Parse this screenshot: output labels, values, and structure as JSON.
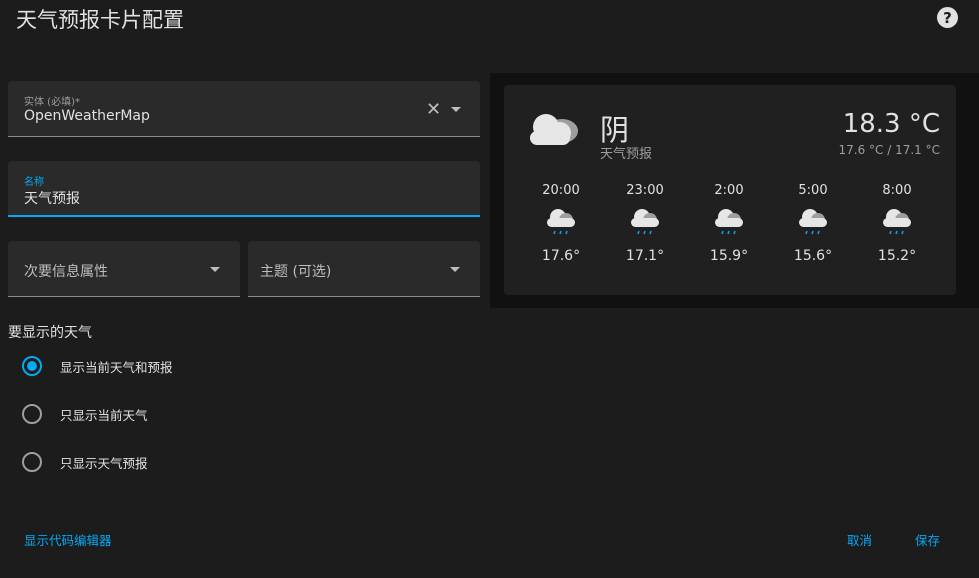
{
  "dialog": {
    "title": "天气预报卡片配置"
  },
  "form": {
    "entity": {
      "label": "实体 (必填)*",
      "value": "OpenWeatherMap"
    },
    "name": {
      "label": "名称",
      "value": "天气预报"
    },
    "secondary": {
      "placeholder": "次要信息属性"
    },
    "theme": {
      "placeholder": "主题 (可选)"
    },
    "show_section": {
      "title": "要显示的天气",
      "options": [
        {
          "label": "显示当前天气和预报",
          "checked": true
        },
        {
          "label": "只显示当前天气",
          "checked": false
        },
        {
          "label": "只显示天气预报",
          "checked": false
        }
      ]
    }
  },
  "actions": {
    "code_editor": "显示代码编辑器",
    "cancel": "取消",
    "save": "保存"
  },
  "preview": {
    "condition": "阴",
    "name": "天气预报",
    "temperature": "18.3 °C",
    "high_low": "17.6 °C / 17.1 °C",
    "forecast": [
      {
        "time": "20:00",
        "temp": "17.6°",
        "icon": "rainy-icon"
      },
      {
        "time": "23:00",
        "temp": "17.1°",
        "icon": "rainy-icon"
      },
      {
        "time": "2:00",
        "temp": "15.9°",
        "icon": "rainy-icon"
      },
      {
        "time": "5:00",
        "temp": "15.6°",
        "icon": "rainy-icon"
      },
      {
        "time": "8:00",
        "temp": "15.2°",
        "icon": "rainy-icon"
      }
    ]
  },
  "colors": {
    "accent": "#03a9f4",
    "background": "#1c1c1c",
    "field": "#2a2a2a",
    "card": "#202020"
  }
}
